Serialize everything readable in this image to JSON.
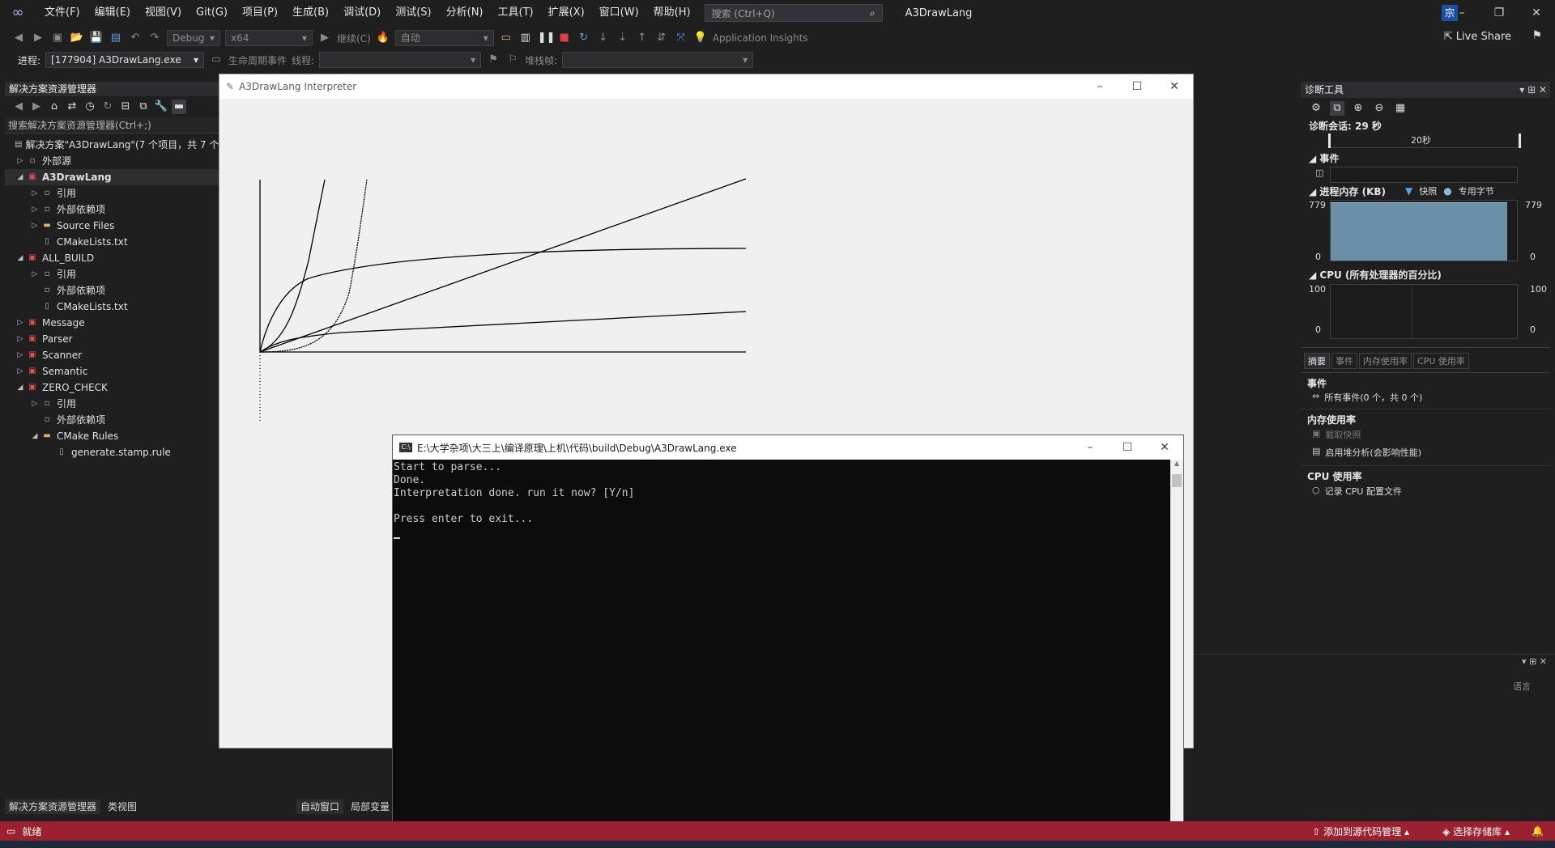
{
  "menubar": {
    "logo": "VS",
    "items": [
      "文件(F)",
      "编辑(E)",
      "视图(V)",
      "Git(G)",
      "项目(P)",
      "生成(B)",
      "调试(D)",
      "测试(S)",
      "分析(N)",
      "工具(T)",
      "扩展(X)",
      "窗口(W)",
      "帮助(H)"
    ],
    "search_placeholder": "搜索 (Ctrl+Q)",
    "app_title": "A3DrawLang",
    "user_initial": "宗"
  },
  "toolbar": {
    "config": "Debug",
    "platform": "x64",
    "continue": "继续(C)",
    "auto": "自动",
    "app_insights": "Application Insights",
    "live_share": "Live Share",
    "process_label": "进程:",
    "process_value": "[177904] A3DrawLang.exe",
    "lifecycle": "生命周期事件",
    "thread_label": "线程:",
    "stack_label": "堆栈帧:"
  },
  "solution_explorer": {
    "title": "解决方案资源管理器",
    "search": "搜索解决方案资源管理器(Ctrl+;)",
    "rows": [
      {
        "indent": 0,
        "arrow": "",
        "icon": "solution",
        "label": "解决方案\"A3DrawLang\"(7 个项目，共 7 个)"
      },
      {
        "indent": 0,
        "arrow": "▷",
        "icon": "ref",
        "label": "外部源"
      },
      {
        "indent": 0,
        "arrow": "◢",
        "icon": "project",
        "label": "A3DrawLang",
        "selected": true
      },
      {
        "indent": 1,
        "arrow": "▷",
        "icon": "ref",
        "label": "引用"
      },
      {
        "indent": 1,
        "arrow": "▷",
        "icon": "ref",
        "label": "外部依赖项"
      },
      {
        "indent": 1,
        "arrow": "▷",
        "icon": "folder",
        "label": "Source Files"
      },
      {
        "indent": 1,
        "arrow": "",
        "icon": "file",
        "label": "CMakeLists.txt"
      },
      {
        "indent": 0,
        "arrow": "◢",
        "icon": "project",
        "label": "ALL_BUILD"
      },
      {
        "indent": 1,
        "arrow": "▷",
        "icon": "ref",
        "label": "引用"
      },
      {
        "indent": 1,
        "arrow": "",
        "icon": "ref",
        "label": "外部依赖项"
      },
      {
        "indent": 1,
        "arrow": "",
        "icon": "file",
        "label": "CMakeLists.txt"
      },
      {
        "indent": 0,
        "arrow": "▷",
        "icon": "project",
        "label": "Message"
      },
      {
        "indent": 0,
        "arrow": "▷",
        "icon": "project",
        "label": "Parser"
      },
      {
        "indent": 0,
        "arrow": "▷",
        "icon": "project",
        "label": "Scanner"
      },
      {
        "indent": 0,
        "arrow": "▷",
        "icon": "project",
        "label": "Semantic"
      },
      {
        "indent": 0,
        "arrow": "◢",
        "icon": "project",
        "label": "ZERO_CHECK"
      },
      {
        "indent": 1,
        "arrow": "▷",
        "icon": "ref",
        "label": "引用"
      },
      {
        "indent": 1,
        "arrow": "",
        "icon": "ref",
        "label": "外部依赖项"
      },
      {
        "indent": 1,
        "arrow": "◢",
        "icon": "folder",
        "label": "CMake Rules"
      },
      {
        "indent": 2,
        "arrow": "",
        "icon": "file",
        "label": "generate.stamp.rule"
      }
    ],
    "tabs": [
      "解决方案资源管理器",
      "类视图"
    ]
  },
  "lower": {
    "tabs": [
      "自动窗口",
      "局部变量"
    ],
    "lang_col": "语言"
  },
  "diagnostics": {
    "title": "诊断工具",
    "session": "诊断会话: 29 秒",
    "timeline_label": "20秒",
    "events_title": "事件",
    "memory_title": "进程内存 (KB)",
    "snapshot": "快照",
    "private_bytes": "专用字节",
    "mem_max": "779",
    "mem_min": "0",
    "cpu_title": "CPU (所有处理器的百分比)",
    "cpu_max": "100",
    "cpu_min": "0",
    "tabs": [
      "摘要",
      "事件",
      "内存使用率",
      "CPU 使用率"
    ],
    "sec_events": "事件",
    "all_events": "所有事件(0 个，共 0 个)",
    "sec_memory": "内存使用率",
    "take_snapshot": "截取快照",
    "heap_profiling": "启用堆分析(会影响性能)",
    "sec_cpu": "CPU 使用率",
    "record_cpu": "记录 CPU 配置文件",
    "accent": "#6b8fa6"
  },
  "interpreter": {
    "title": "A3DrawLang Interpreter"
  },
  "console": {
    "title": "E:\\大学杂项\\大三上\\编译原理\\上机\\代码\\build\\Debug\\A3DrawLang.exe",
    "lines": [
      "Start to parse...",
      "Done.",
      "Interpretation done. run it now? [Y/n]",
      "",
      "Press enter to exit..."
    ]
  },
  "statusbar": {
    "ready": "就绪",
    "add_source": "添加到源代码管理",
    "select_repo": "选择存储库",
    "color": "#9b2130"
  }
}
